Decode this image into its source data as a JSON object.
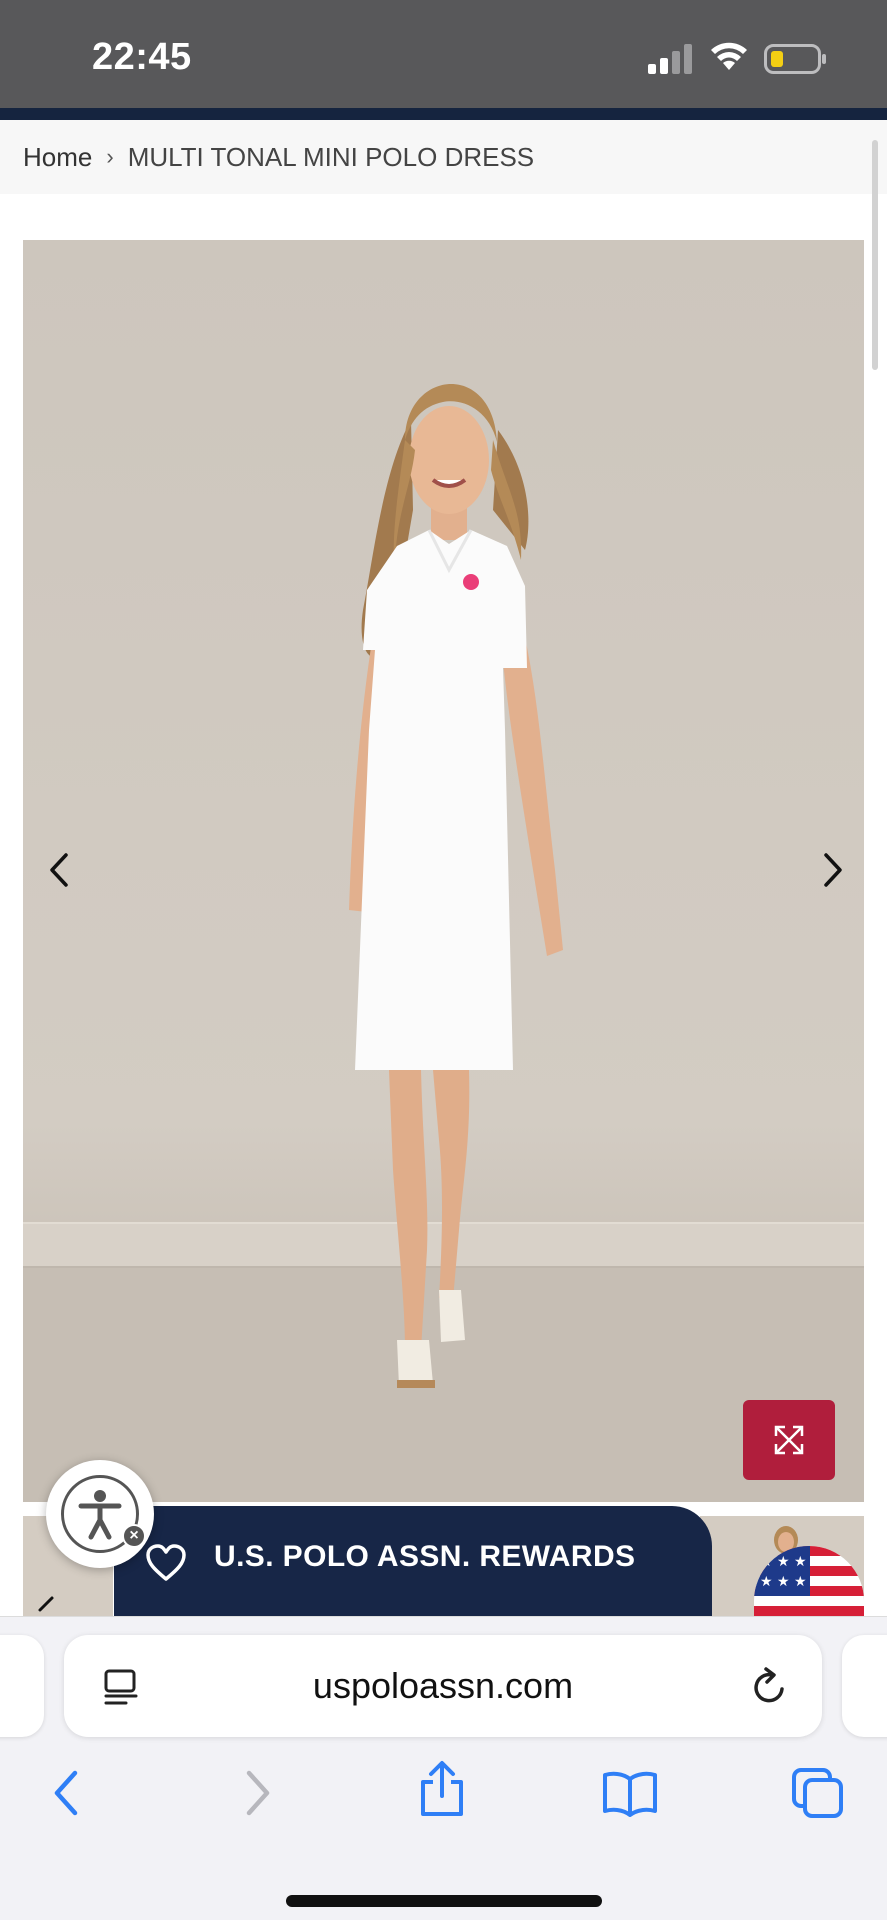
{
  "status_bar": {
    "time": "22:45",
    "signal_icon": "cellular-signal-icon",
    "wifi_icon": "wifi-icon",
    "battery_icon": "battery-low-icon"
  },
  "breadcrumb": {
    "home": "Home",
    "separator": "›",
    "current": "MULTI TONAL MINI POLO DRESS"
  },
  "product_gallery": {
    "prev_icon": "chevron-left-icon",
    "next_icon": "chevron-right-icon",
    "expand_icon": "expand-arrows-icon"
  },
  "rewards_banner": {
    "label": "U.S. POLO ASSN. REWARDS",
    "icon": "heart-outline-icon"
  },
  "browser": {
    "url": "uspoloassn.com",
    "reader_icon": "page-menu-icon",
    "reload_icon": "reload-icon",
    "toolbar": [
      "back-icon",
      "forward-icon",
      "share-icon",
      "bookmarks-icon",
      "tabs-icon"
    ]
  },
  "colors": {
    "status_bar": "#58585a",
    "navy": "#172647",
    "expand_button": "#b01e3c",
    "browser_accent": "#2f7ff6",
    "browser_disabled": "#b7b7bd"
  }
}
